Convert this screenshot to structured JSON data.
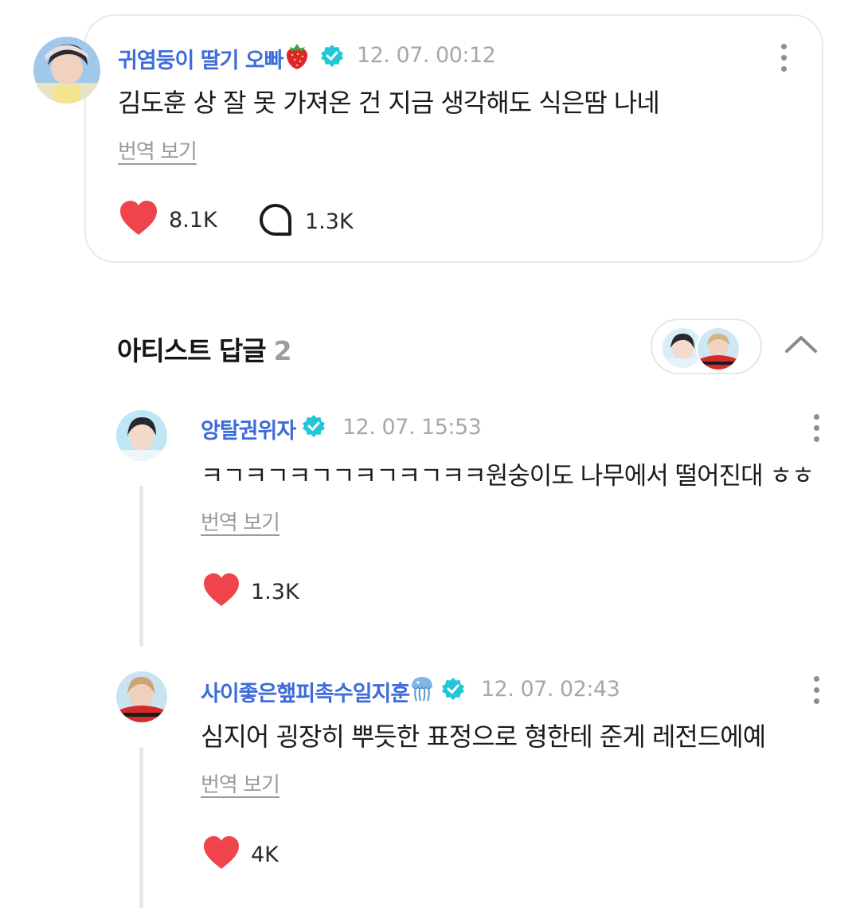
{
  "main_comment": {
    "author": "귀염둥이 딸기 오빠",
    "time": "12. 07. 00:12",
    "text": "김도훈 상 잘 못 가져온 건 지금 생각해도 식은땀 나네",
    "translate_label": "번역 보기",
    "likes": "8.1K",
    "replies": "1.3K"
  },
  "artist_replies": {
    "title": "아티스트 답글",
    "count": "2"
  },
  "replies": [
    {
      "author": "앙탈권위자",
      "time": "12. 07. 15:53",
      "text": "ㅋㄱㅋㄱㅋㄱㄱㅋㄱㅋㄱㅋㅋ원숭이도 나무에서 떨어진대 ㅎㅎ",
      "translate_label": "번역 보기",
      "likes": "1.3K"
    },
    {
      "author": "사이좋은햎피촉수일지훈",
      "time": "12. 07. 02:43",
      "text": "심지어 굉장히 뿌듯한 표정으로 형한테 준게 레전드에예",
      "translate_label": "번역 보기",
      "likes": "4K"
    }
  ],
  "colors": {
    "name": "#3d6cd9",
    "verified": "#21c7d6",
    "heart": "#f0444d",
    "muted": "#a7a7ad"
  }
}
